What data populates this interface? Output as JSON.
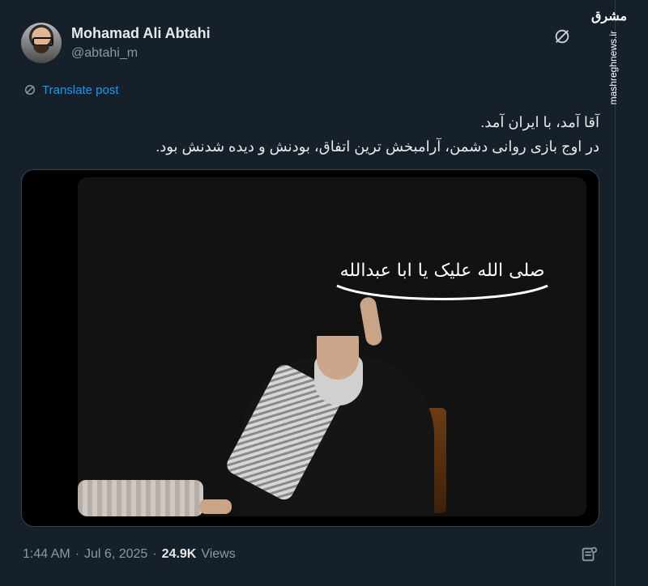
{
  "author": {
    "display_name": "Mohamad Ali Abtahi",
    "handle": "@abtahi_m"
  },
  "watermark": {
    "logo_text": "مشرق",
    "site": "mashreghnews.ir"
  },
  "translate": {
    "label": "Translate post"
  },
  "tweet": {
    "line1": "آقا آمد، با ایران آمد.",
    "line2": "در اوج بازی روانی دشمن، آرامبخش ترین اتفاق، بودنش و دیده شدنش بود."
  },
  "media": {
    "banner_text": "صلی الله علیک یا ابا عبدالله"
  },
  "meta": {
    "time": "1:44 AM",
    "date": "Jul 6, 2025",
    "views_count": "24.9K",
    "views_label": "Views"
  },
  "icons": {
    "grok": "grok-icon",
    "translate": "translate-icon",
    "bookmark": "bookmark-list-icon"
  },
  "colors": {
    "background": "#15202b",
    "link": "#1d9bf0",
    "muted": "#8b98a5"
  }
}
